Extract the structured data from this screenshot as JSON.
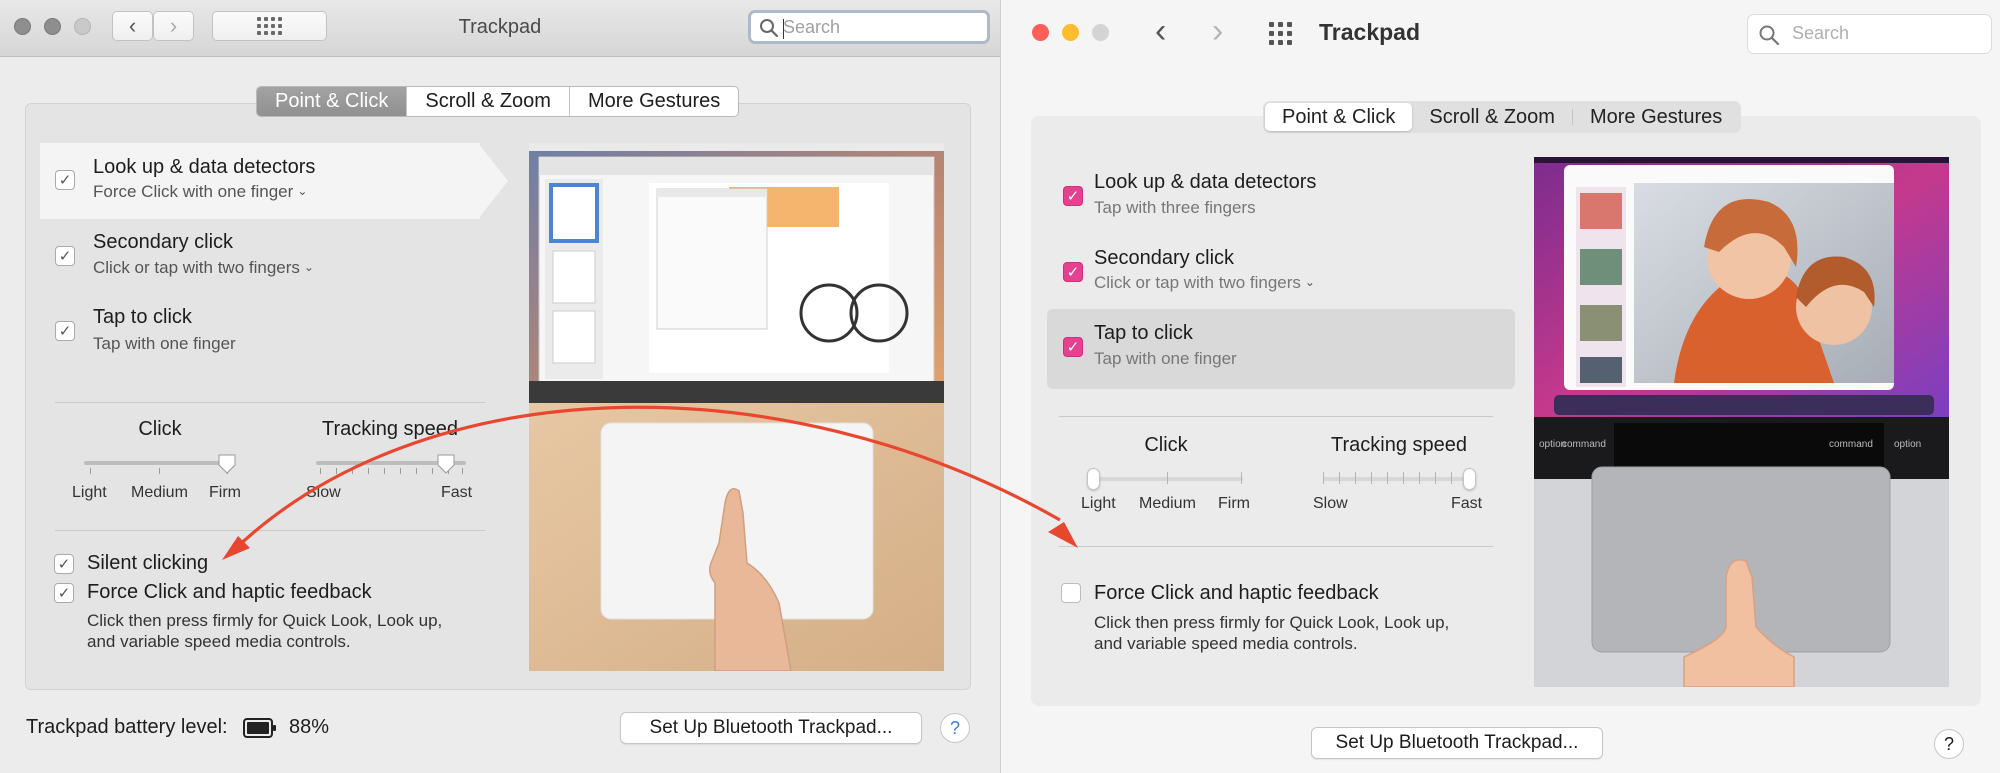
{
  "left": {
    "title": "Trackpad",
    "search_placeholder": "Search",
    "tabs": [
      "Point & Click",
      "Scroll & Zoom",
      "More Gestures"
    ],
    "options": [
      {
        "label": "Look up & data detectors",
        "sub": "Force Click with one finger",
        "checked": true
      },
      {
        "label": "Secondary click",
        "sub": "Click or tap with two fingers",
        "checked": true
      },
      {
        "label": "Tap to click",
        "sub": "Tap with one finger",
        "checked": true
      }
    ],
    "click_slider": {
      "title": "Click",
      "labels": [
        "Light",
        "Medium",
        "Firm"
      ],
      "value": "Firm"
    },
    "tracking_slider": {
      "title": "Tracking speed",
      "labels": [
        "Slow",
        "Fast"
      ],
      "value": 0.85
    },
    "silent_clicking": "Silent clicking",
    "force_click": "Force Click and haptic feedback",
    "force_desc_1": "Click then press firmly for Quick Look, Look up,",
    "force_desc_2": "and variable speed media controls.",
    "battery_label": "Trackpad battery level:",
    "battery_value": "88%",
    "setup_button": "Set Up Bluetooth Trackpad...",
    "help": "?"
  },
  "right": {
    "title": "Trackpad",
    "search_placeholder": "Search",
    "tabs": [
      "Point & Click",
      "Scroll & Zoom",
      "More Gestures"
    ],
    "options": [
      {
        "label": "Look up & data detectors",
        "sub": "Tap with three fingers",
        "checked": true
      },
      {
        "label": "Secondary click",
        "sub": "Click or tap with two fingers",
        "checked": true
      },
      {
        "label": "Tap to click",
        "sub": "Tap with one finger",
        "checked": true
      }
    ],
    "click_slider": {
      "title": "Click",
      "labels": [
        "Light",
        "Medium",
        "Firm"
      ],
      "value": "Light"
    },
    "tracking_slider": {
      "title": "Tracking speed",
      "labels": [
        "Slow",
        "Fast"
      ],
      "value": 1.0
    },
    "force_click": "Force Click and haptic feedback",
    "force_desc_1": "Click then press firmly for Quick Look, Look up,",
    "force_desc_2": "and variable speed media controls.",
    "setup_button": "Set Up Bluetooth Trackpad...",
    "help": "?",
    "keyboard_keys": [
      "option",
      "command",
      "command",
      "option"
    ]
  },
  "colors": {
    "accent_pink": "#e4418f",
    "arrow_red": "#e8472f",
    "traffic_red": "#fe5f57",
    "traffic_yellow": "#febc2e"
  }
}
